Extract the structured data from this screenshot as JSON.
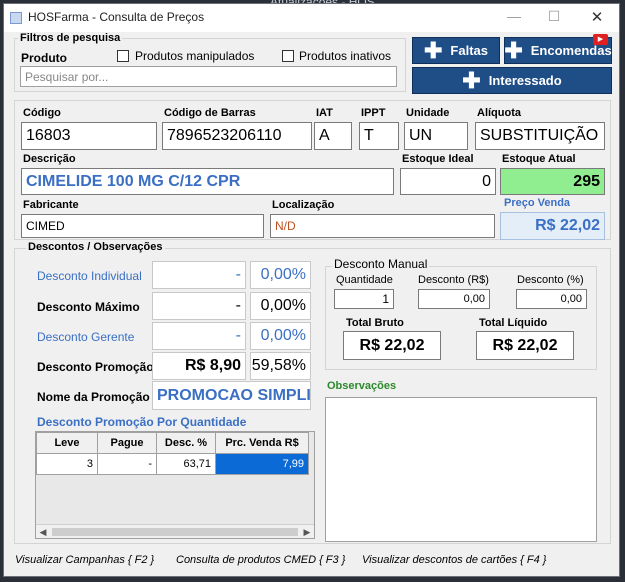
{
  "background": {
    "partial_title": "Atualizações - HOS"
  },
  "window": {
    "title": "HOSFarma - Consulta de Preços"
  },
  "filters": {
    "title": "Filtros de pesquisa",
    "produto_label": "Produto",
    "manipulados_label": "Produtos manipulados",
    "inativos_label": "Produtos inativos",
    "search_placeholder": "Pesquisar por..."
  },
  "buttons": {
    "faltas": "Faltas",
    "encomendas": "Encomendas",
    "interessado": "Interessado"
  },
  "product": {
    "codigo_label": "Código",
    "codigo": "16803",
    "barras_label": "Código de Barras",
    "barras": "7896523206110",
    "iat_label": "IAT",
    "iat": "A",
    "ippt_label": "IPPT",
    "ippt": "T",
    "unidade_label": "Unidade",
    "unidade": "UN",
    "aliquota_label": "Alíquota",
    "aliquota": "SUBSTITUIÇÃO",
    "descricao_label": "Descrição",
    "descricao": "CIMELIDE 100 MG C/12 CPR",
    "estoque_ideal_label": "Estoque Ideal",
    "estoque_ideal": "0",
    "estoque_atual_label": "Estoque Atual",
    "estoque_atual": "295",
    "fabricante_label": "Fabricante",
    "fabricante": "CIMED",
    "localizacao_label": "Localização",
    "localizacao": "N/D",
    "preco_venda_label": "Preço Venda",
    "preco_venda": "R$ 22,02"
  },
  "descontos": {
    "title": "Descontos / Observações",
    "individual_label": "Desconto Individual",
    "individual_value": "-",
    "individual_pct": "0,00%",
    "maximo_label": "Desconto Máximo",
    "maximo_value": "-",
    "maximo_pct": "0,00%",
    "gerente_label": "Desconto Gerente",
    "gerente_value": "-",
    "gerente_pct": "0,00%",
    "promocao_label": "Desconto Promoção",
    "promocao_value": "R$ 8,90",
    "promocao_pct": "59,58%",
    "nome_promocao_label": "Nome da Promoção",
    "nome_promocao": "PROMOCAO SIMPLII",
    "qtd_title": "Desconto Promoção Por Quantidade",
    "table": {
      "columns": [
        "Leve",
        "Pague",
        "Desc. %",
        "Prc. Venda R$"
      ],
      "rows": [
        [
          "3",
          "-",
          "63,71",
          "7,99"
        ]
      ]
    }
  },
  "manual": {
    "title": "Desconto Manual",
    "quantidade_label": "Quantidade",
    "quantidade": "1",
    "desc_rs_label": "Desconto (R$)",
    "desc_rs": "0,00",
    "desc_pct_label": "Desconto (%)",
    "desc_pct": "0,00",
    "total_bruto_label": "Total Bruto",
    "total_bruto": "R$ 22,02",
    "total_liquido_label": "Total Líquido",
    "total_liquido": "R$ 22,02"
  },
  "observacoes": {
    "title": "Observações"
  },
  "statusbar": {
    "campanhas": "Visualizar Campanhas { F2 }",
    "cmed": "Consulta de produtos CMED { F3 }",
    "cartoes": "Visualizar descontos de cartões { F4 }"
  },
  "colors": {
    "accent_blue": "#1f4e87",
    "label_blue": "#3a6fc4",
    "stock_green": "#90ee90",
    "selection": "#0b6ad6"
  }
}
